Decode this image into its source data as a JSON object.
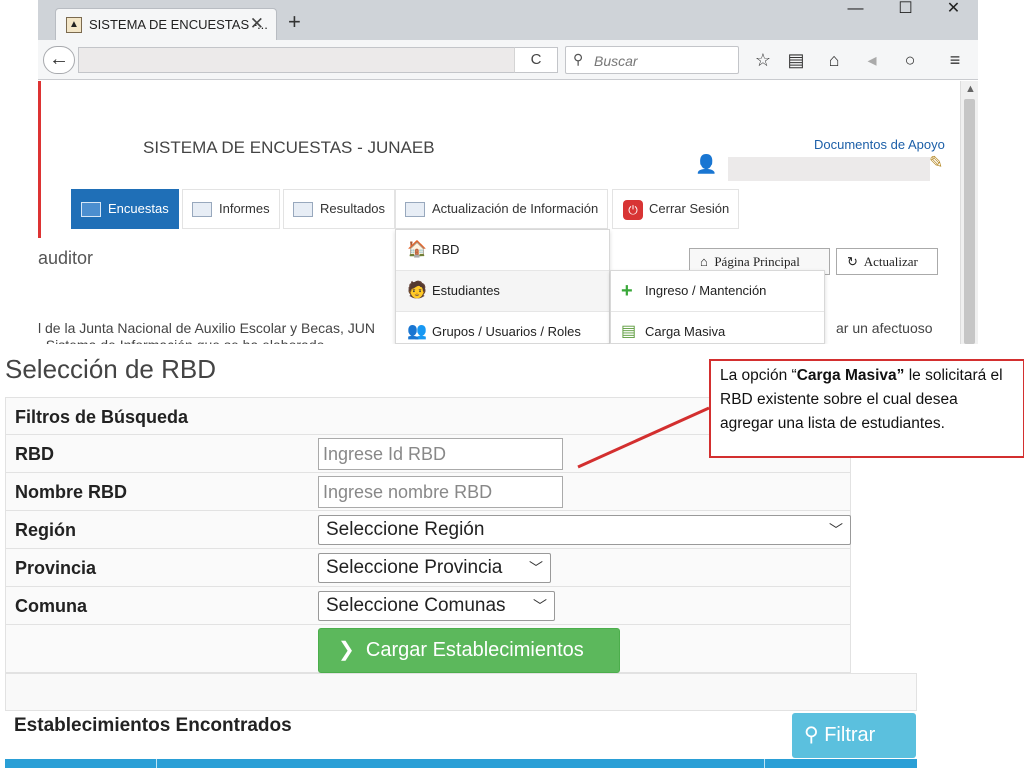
{
  "browser": {
    "tab_title": "SISTEMA DE ENCUESTAS -...",
    "tab_close": "✕",
    "new_tab": "+",
    "search_placeholder": "Buscar",
    "reload": "C",
    "window_min": "—",
    "window_max": "☐",
    "window_close": "✕"
  },
  "header": {
    "app_title": "SISTEMA DE ENCUESTAS - JUNAEB",
    "docs_link": "Documentos de Apoyo"
  },
  "menu": [
    {
      "label": "Encuestas",
      "active": true
    },
    {
      "label": "Informes"
    },
    {
      "label": "Resultados"
    },
    {
      "label": "Actualización de Información"
    },
    {
      "label": "Cerrar Sesión"
    }
  ],
  "page": {
    "role": "auditor",
    "home_button": "Página Principal",
    "refresh_button": "Actualizar",
    "body_text_left": "l de la Junta Nacional de Auxilio Escolar y Becas, JUN",
    "body_text_right": "ar un afectuoso",
    "body_text_line2": "         , Sistema de Información que se ha elaborado"
  },
  "dropdown": {
    "items": [
      "RBD",
      "Estudiantes",
      "Grupos / Usuarios / Roles"
    ]
  },
  "submenu": {
    "items": [
      "Ingreso / Mantención",
      "Carga Masiva"
    ]
  },
  "form": {
    "title": "Selección de RBD",
    "filters_heading": "Filtros de Búsqueda",
    "rbd_label": "RBD",
    "rbd_placeholder": "Ingrese Id RBD",
    "name_label": "Nombre RBD",
    "name_placeholder": "Ingrese nombre RBD",
    "region_label": "Región",
    "region_value": "Seleccione Región",
    "provincia_label": "Provincia",
    "provincia_value": "Seleccione Provincia",
    "comuna_label": "Comuna",
    "comuna_value": "Seleccione Comunas",
    "load_button": "Cargar Establecimientos",
    "found_heading": "Establecimientos Encontrados",
    "filter_button": "Filtrar"
  },
  "callout": {
    "prefix": "La opción “",
    "bold": "Carga Masiva”",
    "suffix": " le solicitará el RBD existente  sobre el cual desea agregar una lista de estudiantes."
  },
  "colors": {
    "accent_blue": "#1f6fb7",
    "callout_red": "#d32f2f",
    "load_green": "#5cb85c",
    "filter_cyan": "#5bc0de"
  }
}
